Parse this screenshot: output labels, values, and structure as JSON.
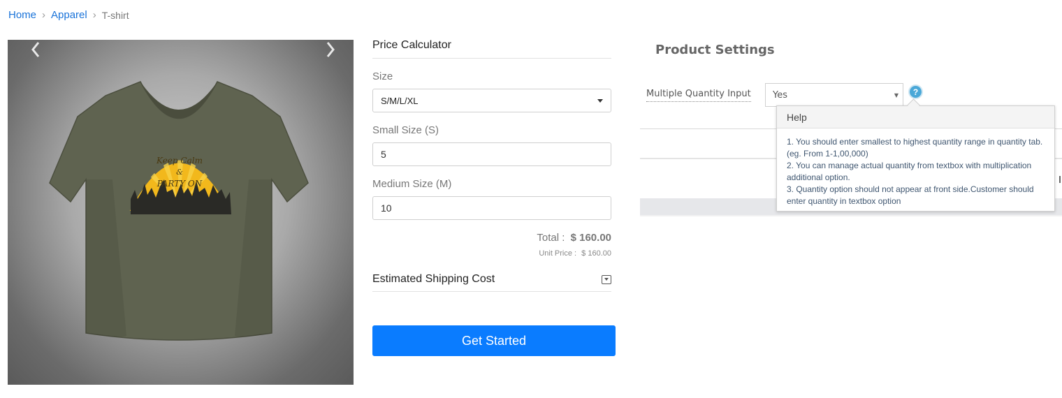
{
  "breadcrumb": {
    "items": [
      "Home",
      "Apparel"
    ],
    "current": "T-shirt"
  },
  "gallery": {
    "image_alt": "Olive green V-neck t-shirt",
    "print_text": [
      "Keep Calm",
      "&",
      "PARTY ON"
    ],
    "shirt_color": "#5f6350",
    "print_color": "#f2b81c"
  },
  "calculator": {
    "title": "Price Calculator",
    "size_label": "Size",
    "size_value": "S/M/L/XL",
    "small_label": "Small Size (S)",
    "small_value": "5",
    "medium_label": "Medium Size (M)",
    "medium_value": "10",
    "total_label": "Total :",
    "total_value": "$ 160.00",
    "unit_label": "Unit Price :",
    "unit_value": "$ 160.00",
    "shipping_label": "Estimated Shipping Cost",
    "cta_label": "Get Started",
    "cta_color": "#0a7cff"
  },
  "settings": {
    "title": "Product Settings",
    "mqi_label": "Multiple Quantity Input",
    "mqi_value": "Yes",
    "help_glyph": "?",
    "tooltip": {
      "title": "Help",
      "lines": [
        "1. You should enter smallest to highest quantity range in quantity tab. (eg. From 1-1,00,000)",
        "2. You can manage actual quantity from textbox with multiplication additional option.",
        "3. Quantity option should not appear at front side.Customer should enter quantity in textbox option"
      ]
    }
  }
}
